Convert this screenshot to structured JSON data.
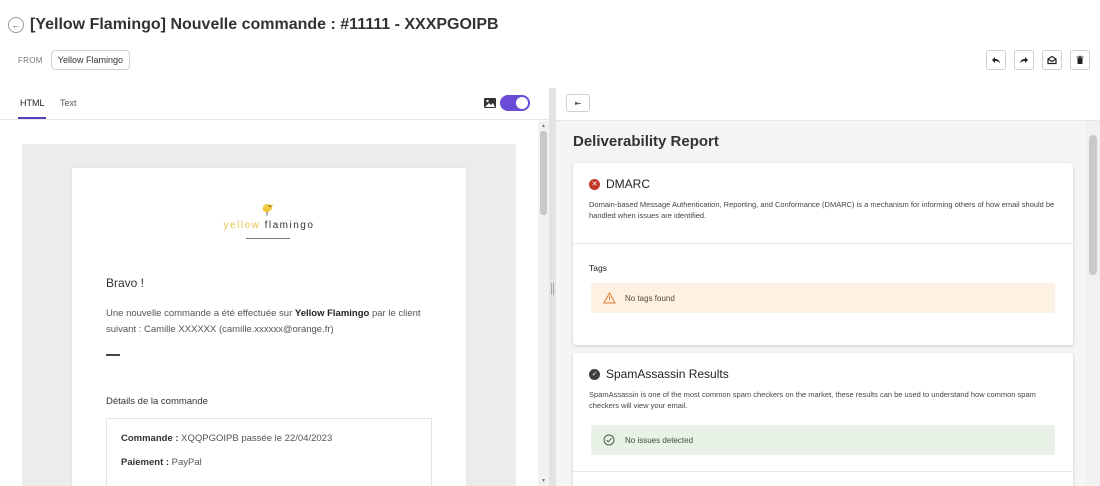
{
  "header": {
    "back_icon": "back-arrow-icon",
    "title": "[Yellow Flamingo] Nouvelle commande : #11111 - XXXPGOIPB",
    "from_label": "FROM",
    "from_value": "Yellow Flamingo",
    "actions": [
      "reply-icon",
      "forward-icon",
      "mark-unread-icon",
      "delete-icon"
    ]
  },
  "left": {
    "tabs": [
      {
        "label": "HTML",
        "active": true
      },
      {
        "label": "Text",
        "active": false
      }
    ],
    "image_toggle_icon": "image-icon",
    "toggle_on": true,
    "accent_color": "#5b3fbf"
  },
  "email": {
    "logo_text_yellow": "yellow",
    "logo_text_dark": "flamingo",
    "greeting": "Bravo !",
    "intro_before": "Une nouvelle commande a été effectuée sur ",
    "intro_shop": "Yellow Flamingo",
    "intro_after": " par le client suivant : Camille XXXXXX (camille.xxxxxx@orange.fr)",
    "details_title": "Détails de la commande",
    "order_label": "Commande :",
    "order_value": " XQQPGOIPB passée le 22/04/2023",
    "payment_label": "Paiement :",
    "payment_value": " PayPal"
  },
  "report": {
    "collapse_icon": "collapse-arrow-icon",
    "title": "Deliverability Report",
    "dmarc": {
      "status": "error",
      "status_color": "#c0392b",
      "title": "DMARC",
      "description": "Domain-based Message Authentication, Reporting, and Conformance (DMARC) is a mechanism for informing others of how email should be handled when issues are identified.",
      "tags_title": "Tags",
      "tags_empty": "No tags found"
    },
    "spam": {
      "status": "ok",
      "title": "SpamAssassin Results",
      "description": "SpamAssassin is one of the most common spam checkers on the market, these results can be used to understand how common spam checkers will view your email.",
      "result": "No issues detected"
    }
  }
}
